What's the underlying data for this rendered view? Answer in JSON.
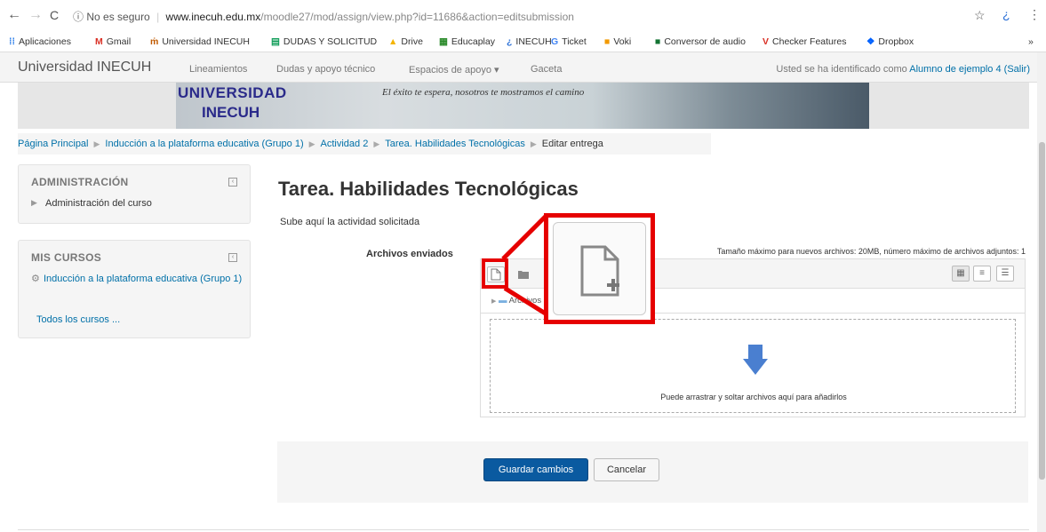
{
  "browser": {
    "security_label": "No es seguro",
    "url_host": "www.inecuh.edu.mx",
    "url_path": "/moodle27/mod/assign/view.php?id=11686&action=editsubmission",
    "bookmarks": [
      {
        "label": "Aplicaciones",
        "icon": "apps-grid-icon"
      },
      {
        "label": "Gmail",
        "icon": "gmail-icon"
      },
      {
        "label": "Universidad INECUH",
        "icon": "inecuh-icon"
      },
      {
        "label": "DUDAS Y SOLICITUD",
        "icon": "sheets-icon"
      },
      {
        "label": "Drive",
        "icon": "drive-icon"
      },
      {
        "label": "Educaplay",
        "icon": "educaplay-icon"
      },
      {
        "label": "INECUH",
        "icon": "inecuh-icon"
      },
      {
        "label": "Ticket",
        "icon": "google-icon"
      },
      {
        "label": "Voki",
        "icon": "voki-icon"
      },
      {
        "label": "Conversor de audio",
        "icon": "audio-icon"
      },
      {
        "label": "Checker Features",
        "icon": "checker-icon"
      },
      {
        "label": "Dropbox",
        "icon": "dropbox-icon"
      }
    ],
    "more_label": "»"
  },
  "navbar": {
    "brand": "Universidad INECUH",
    "links": [
      "Lineamientos",
      "Dudas y apoyo técnico",
      "Espacios de apoyo ▾",
      "Gaceta"
    ],
    "login_prefix": "Usted se ha identificado como",
    "login_user": "Alumno de ejemplo 4",
    "logout": "(Salir)"
  },
  "banner": {
    "logo_line1": "UNIVERSIDAD",
    "logo_line2": "INECUH",
    "slogan": "El éxito te espera, nosotros te mostramos el camino"
  },
  "breadcrumb": {
    "items": [
      "Página Principal",
      "Inducción a la plataforma educativa (Grupo 1)",
      "Actividad 2",
      "Tarea. Habilidades Tecnológicas"
    ],
    "current": "Editar entrega"
  },
  "blocks": {
    "admin": {
      "title": "ADMINISTRACIÓN",
      "item": "Administración del curso"
    },
    "courses": {
      "title": "MIS CURSOS",
      "course": "Inducción a la plataforma educativa (Grupo 1)",
      "all": "Todos los cursos ..."
    }
  },
  "main": {
    "title": "Tarea. Habilidades Tecnológicas",
    "intro": "Sube aquí la actividad solicitada",
    "files_label": "Archivos enviados",
    "max_info": "Tamaño máximo para nuevos archivos: 20MB, número máximo de archivos adjuntos: 1",
    "folder_label": "Archivos",
    "drop_text": "Puede arrastrar y soltar archivos aquí para añadirlos",
    "save_button": "Guardar cambios",
    "cancel_button": "Cancelar"
  },
  "colors": {
    "highlight": "#e60000",
    "primary_button": "#0a5aa0",
    "link": "#0070a8",
    "drop_arrow": "#4a7fd0"
  }
}
